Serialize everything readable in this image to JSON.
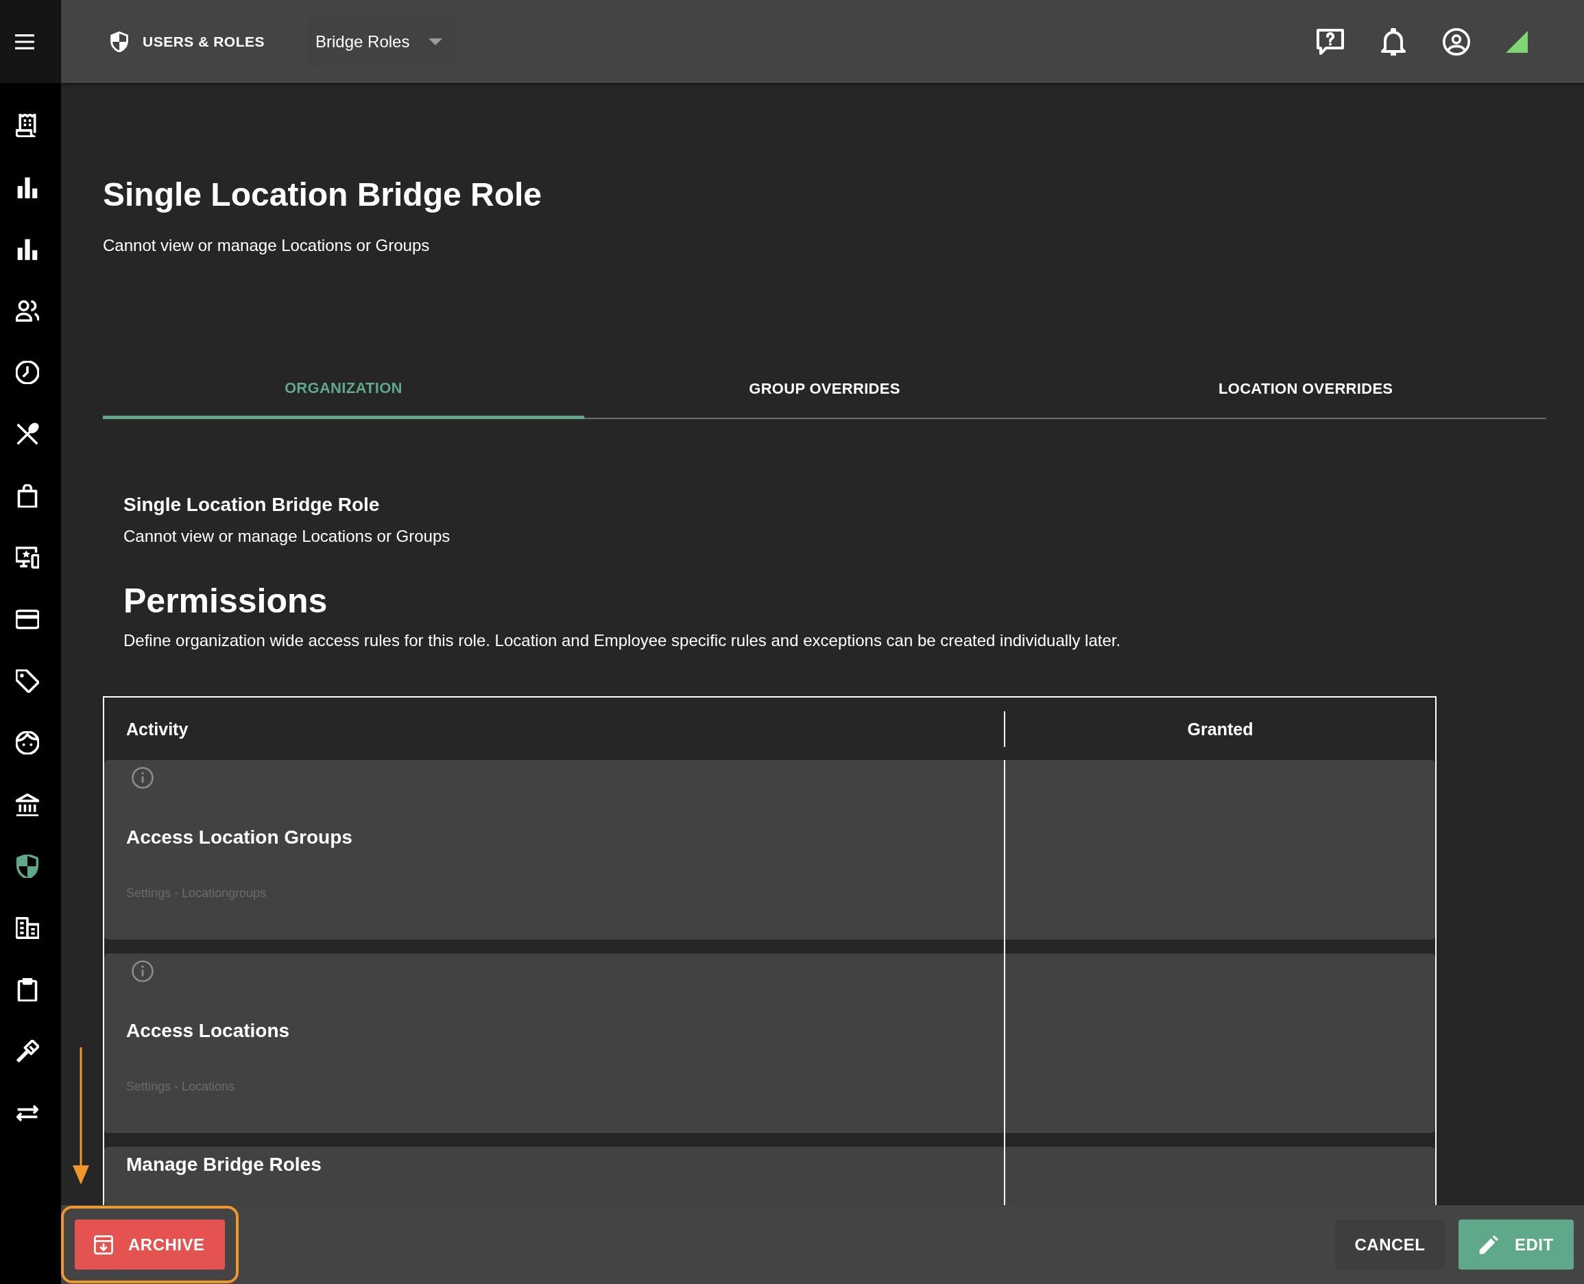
{
  "sidebar": {
    "items": [
      {
        "selected": false
      },
      {
        "selected": false
      },
      {
        "selected": false
      },
      {
        "selected": false
      },
      {
        "selected": false
      },
      {
        "selected": false
      },
      {
        "selected": false
      },
      {
        "selected": false
      },
      {
        "selected": false
      },
      {
        "selected": false
      },
      {
        "selected": false
      },
      {
        "selected": false
      },
      {
        "selected": true
      },
      {
        "selected": false
      },
      {
        "selected": false
      },
      {
        "selected": false
      },
      {
        "selected": false
      }
    ]
  },
  "top_bar": {
    "section": "USERS & ROLES",
    "role_select": {
      "value": "Bridge Roles"
    }
  },
  "header": {
    "title": "Single Location Bridge Role",
    "subtitle": "Cannot view or manage Locations or Groups"
  },
  "tabs": [
    {
      "label": "ORGANIZATION",
      "selected": true
    },
    {
      "label": "GROUP OVERRIDES",
      "selected": false
    },
    {
      "label": "LOCATION OVERRIDES",
      "selected": false
    }
  ],
  "role_summary": {
    "title": "Single Location Bridge Role",
    "subtitle": "Cannot view or manage Locations or Groups"
  },
  "permissions": {
    "heading": "Permissions",
    "description": "Define organization wide access rules for this role. Location and Employee specific rules and exceptions can be created individually later."
  },
  "table": {
    "columns": [
      "Activity",
      "Granted"
    ],
    "rows": [
      {
        "activity": "Access Location Groups",
        "category": "Settings - Locationgroups",
        "info": true
      },
      {
        "activity": "Access Locations",
        "category": "Settings - Locations",
        "info": true
      },
      {
        "activity": "Manage Bridge Roles",
        "info": false
      }
    ]
  },
  "footer": {
    "buttons": [
      {
        "label": "ARCHIVE",
        "kind": "danger",
        "highlighted": true
      },
      {
        "label": "CANCEL",
        "kind": "flat",
        "highlighted": false
      },
      {
        "label": "EDIT",
        "kind": "primary",
        "highlighted": false
      }
    ]
  }
}
